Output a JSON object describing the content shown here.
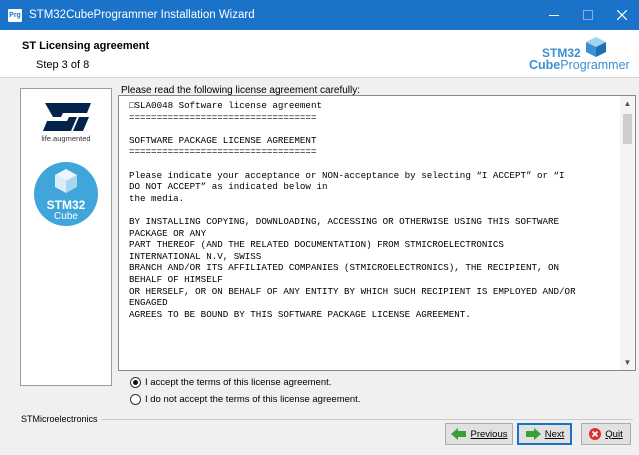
{
  "window": {
    "app_icon_text": "Prg",
    "title": "STM32CubeProgrammer Installation Wizard",
    "controls": [
      "minimize-icon",
      "maximize-icon",
      "close-icon"
    ]
  },
  "header": {
    "step_title": "ST Licensing agreement",
    "step_subtitle": "Step 3 of 8",
    "brand_top": "STM32",
    "brand_bold": "Cube",
    "brand_rest": "Programmer"
  },
  "side_panel": {
    "st_tagline": "life.augmented",
    "cube_title": "STM32",
    "cube_subtitle": "Cube"
  },
  "license": {
    "instruction": "Please read the following license agreement carefully:",
    "text": "□SLA0048 Software license agreement\n==================================\n\nSOFTWARE PACKAGE LICENSE AGREEMENT\n==================================\n\nPlease indicate your acceptance or NON-acceptance by selecting “I ACCEPT” or “I\nDO NOT ACCEPT” as indicated below in\nthe media.\n\nBY INSTALLING COPYING, DOWNLOADING, ACCESSING OR OTHERWISE USING THIS SOFTWARE\nPACKAGE OR ANY\nPART THEREOF (AND THE RELATED DOCUMENTATION) FROM STMICROELECTRONICS\nINTERNATIONAL N.V, SWISS\nBRANCH AND/OR ITS AFFILIATED COMPANIES (STMICROELECTRONICS), THE RECIPIENT, ON\nBEHALF OF HIMSELF\nOR HERSELF, OR ON BEHALF OF ANY ENTITY BY WHICH SUCH RECIPIENT IS EMPLOYED AND/OR\nENGAGED\nAGREES TO BE BOUND BY THIS SOFTWARE PACKAGE LICENSE AGREEMENT."
  },
  "options": {
    "accept_label": "I accept the terms of this license agreement.",
    "decline_label": "I do not accept the terms of this license agreement.",
    "selected": "accept"
  },
  "footer": {
    "vendor": "STMicroelectronics",
    "previous_label": "Previous",
    "next_label": "Next",
    "quit_label": "Quit"
  },
  "colors": {
    "titlebar": "#1a73c9",
    "brand_blue": "#3d8fd0",
    "cube_circle": "#40a5da",
    "st_logo": "#03234b"
  }
}
